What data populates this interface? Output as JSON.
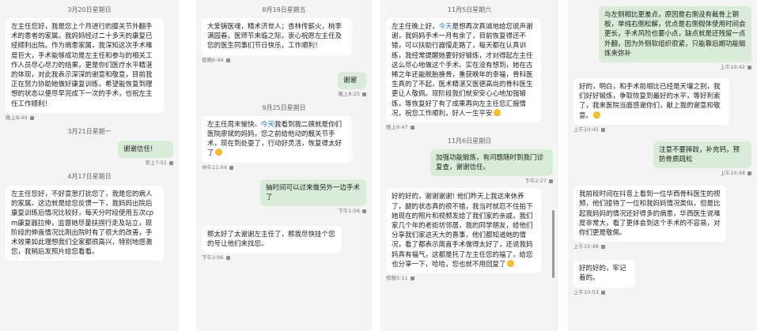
{
  "panels": [
    {
      "dates": [
        "3月20日星期日",
        "3月21日星期一",
        "4月17日星期日"
      ],
      "messages": [
        {
          "text": "左主任您好，我是您上个月进行的膝关节外翻手术的患者的家属。我妈妈经过二十多天的康复已经顺利出院。作为病患家属，我深知这次手术难度巨大，手术能够成功是左主任和参与的相关工作人员尽心尽力的结果，更是你们医疗水平精湛的体现，对此我表示深深的谢意和敬意，目前我正在努力协助她做好康复训练，希望能恢复到理想的状态以便尽早完成下一次的手术，也祝左主任工作顺利！",
          "time": "晚上8:49"
        },
        {
          "text": "谢谢信任!",
          "time": "早上7:51"
        },
        {
          "text": "左主任您好，不好意思打扰您了，我是您的病人的家属。这边就是给您反馈一下，我妈妈出院后康复训练后情况比较好，每天分时段使用五次cpm康复器拉伸，监督她尽量扶拐行走及站立，现阶段的伸直情况比刚出院时有了很大的改善，手术效果如此理想我们全家都很高兴，特别地感激您，我稍后发照片给您看看。",
          "time": ""
        }
      ]
    },
    {
      "dates": [
        "8月19日星期五",
        "9月25日星期日"
      ],
      "messages": [
        {
          "text": "大爱铸医魂，精术济世人；杏林传薪火，桃李满园春。医师节来临之际，衷心祝愿左主任及您的医生同事们节日快乐，工作顺利！",
          "time": "傍晚6:44"
        },
        {
          "text": "谢谢",
          "time": "晚上8:25"
        },
        {
          "text_before_link": "左主任周末愉快。",
          "link": "今天",
          "text_after_link": "我看到我二姨就是你们医院廖斌的妈妈，您之前给他动的髋关节手术，现在到处耍了，行动好灵活，恢复得太好了",
          "time": "中午11:04"
        },
        {
          "text": "抽时间可以过来做另外一边手术了",
          "time": "下午1:56"
        },
        {
          "text": "那太好了太谢谢左主任了，那我尽快挂个您的号让他们来找您。",
          "time": "下午2:06"
        }
      ]
    },
    {
      "dates": [
        "11月5日星期六",
        "11月6日星期日"
      ],
      "messages": [
        {
          "text_before_link": "左主任晚上好，",
          "link": "今天",
          "text_after_link": "是想再次真诚地给您说声谢谢，我妈妈手术一月有余了，目前恢复得还不错，可以扶助行器慢走路了，每天都在认真训练，我经常提醒她要好好锻炼，才对得起左主任这么尽心地做这个手术。实在没有想到，她在古稀之年还能脱胎换骨，重获晚年的幸福，骨科医生真的了不起，医术精湛又医德高尚的骨科医生更让人敬佩。现阶段我们就安安心心地加强锻炼，等恢复好了有了成果再向左主任您汇报情况，祝您工作顺利，好人一生平安",
          "time": "晚上9:47"
        },
        {
          "text": "加强功能锻炼，有问题随时到我门诊复查，谢谢信任。",
          "time": "下午2:27"
        },
        {
          "text": "好的好的，谢谢谢谢! 他们昨天上我这来休养了，腿的状态真的很不错，我当时就忍不住拍下她现在的照片和视频发给了我们家的亲戚，我们家几个年的老街坊邻居，我的同学朋友，给他们分享我们家这天大的喜事，他们都知道她的情况，看了都表示简直手术做得太好了，还说我妈妈真有福气，这都是托了左主任您的福了，给您也分享一下，哈哈，您也就不用回复了",
          "time": "傍晚5:11"
        }
      ]
    },
    {
      "top_cut": "",
      "messages": [
        {
          "text": "与左侧相比更差点，原因是右侧没有截骨上钢板，单纯右侧松解，优点是右侧假体使用时间会更长，手术风险也要小点，缺点就是还残留一点外翻，因为外侧软组织很紧，只能靠后期功能锻炼来弥补",
          "time": "上午10:42"
        },
        {
          "text": "好的，明白，和手术前相比已经是天壤之别，我们好好锻炼，争取恢复到最好的水平，等好利索了，我来医院当面感谢你们，献上我的谢意和敬意。",
          "time": "上午10:45"
        },
        {
          "text": "注意不要摔跤，补充钙，预防骨质疏松",
          "time": "上午10:48"
        },
        {
          "text": "我前段时间在抖音上看到一位华西骨科医生的视频，他们接待了一位和我妈妈情况类似，但是比起我妈妈的情况还好得多的病患，华西医生说难度非常大，看了更体会到这个手术的不容易，对你们更是敬佩。",
          "time": "上午10:48"
        },
        {
          "text": "好的好的，牢记着的。",
          "time": "上午10:53"
        }
      ]
    }
  ],
  "colors": {
    "incoming": "#ffffff",
    "outgoing": "#d9ecd7",
    "background": "#f4f4f4",
    "link": "#1c76d9",
    "emoji": "#f3bf2e"
  }
}
